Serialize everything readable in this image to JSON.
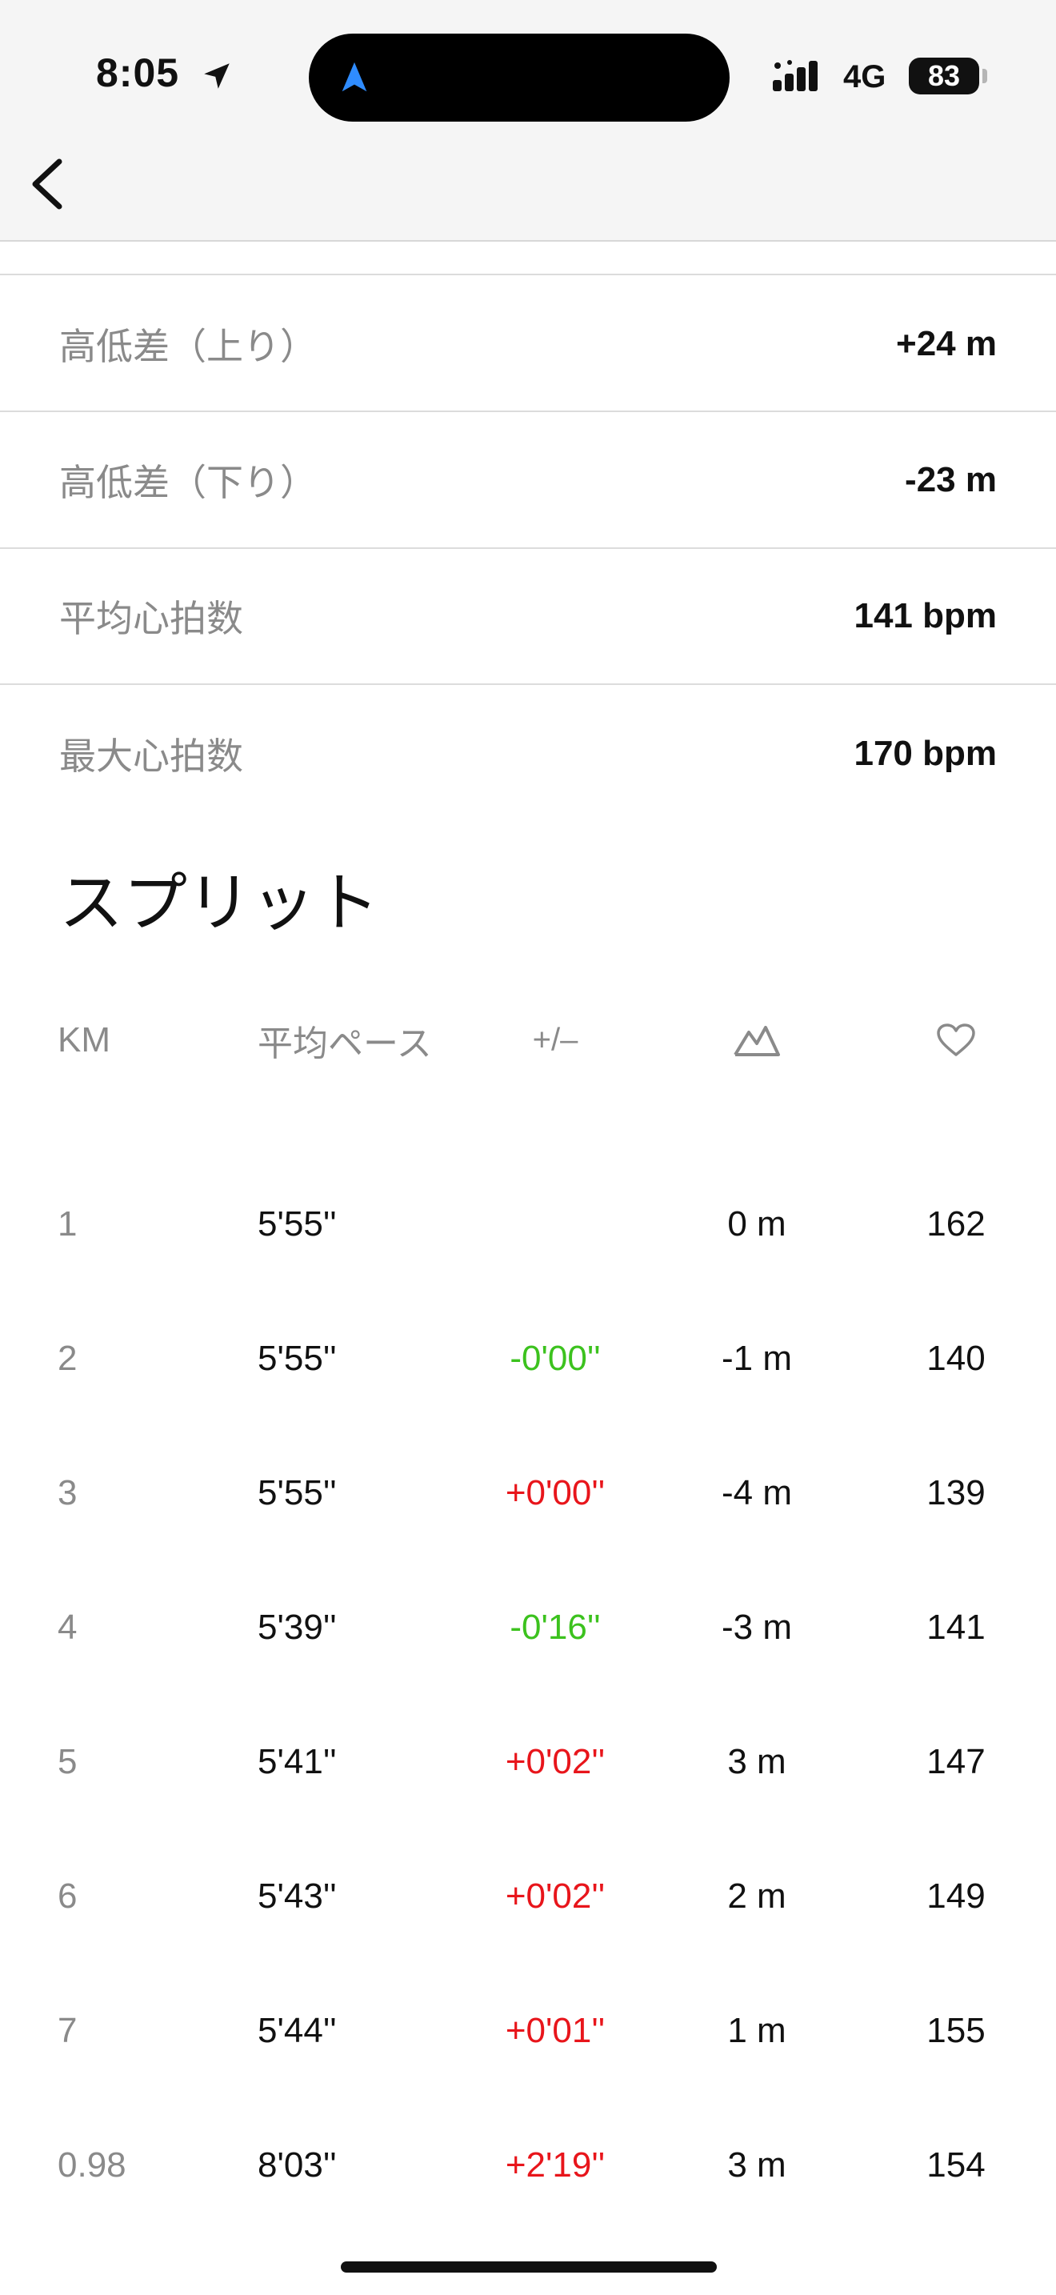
{
  "status_bar": {
    "time": "8:05",
    "network": "4G",
    "battery": "83"
  },
  "stats": [
    {
      "label": "高低差（上り）",
      "value": "+24 m"
    },
    {
      "label": "高低差（下り）",
      "value": "-23 m"
    },
    {
      "label": "平均心拍数",
      "value": "141 bpm"
    },
    {
      "label": "最大心拍数",
      "value": "170 bpm"
    }
  ],
  "splits": {
    "title": "スプリット",
    "headers": {
      "km": "KM",
      "pace": "平均ペース",
      "diff": "+/–",
      "elevation_icon": "mountain-icon",
      "heart_rate_icon": "heart-icon"
    },
    "rows": [
      {
        "km": "1",
        "pace": "5'55''",
        "diff": "",
        "diff_trend": "none",
        "elevation": "0 m",
        "heart_rate": "162"
      },
      {
        "km": "2",
        "pace": "5'55''",
        "diff": "-0'00''",
        "diff_trend": "faster",
        "elevation": "-1 m",
        "heart_rate": "140"
      },
      {
        "km": "3",
        "pace": "5'55''",
        "diff": "+0'00''",
        "diff_trend": "slower",
        "elevation": "-4 m",
        "heart_rate": "139"
      },
      {
        "km": "4",
        "pace": "5'39''",
        "diff": "-0'16''",
        "diff_trend": "faster",
        "elevation": "-3 m",
        "heart_rate": "141"
      },
      {
        "km": "5",
        "pace": "5'41''",
        "diff": "+0'02''",
        "diff_trend": "slower",
        "elevation": "3 m",
        "heart_rate": "147"
      },
      {
        "km": "6",
        "pace": "5'43''",
        "diff": "+0'02''",
        "diff_trend": "slower",
        "elevation": "2 m",
        "heart_rate": "149"
      },
      {
        "km": "7",
        "pace": "5'44''",
        "diff": "+0'01''",
        "diff_trend": "slower",
        "elevation": "1 m",
        "heart_rate": "155"
      },
      {
        "km": "0.98",
        "pace": "8'03''",
        "diff": "+2'19''",
        "diff_trend": "slower",
        "elevation": "3 m",
        "heart_rate": "154"
      }
    ]
  },
  "colors": {
    "faster": "#3cc21e",
    "slower": "#e8151b",
    "label_gray": "#8a8a8a",
    "nav_accent": "#2f8cff"
  }
}
